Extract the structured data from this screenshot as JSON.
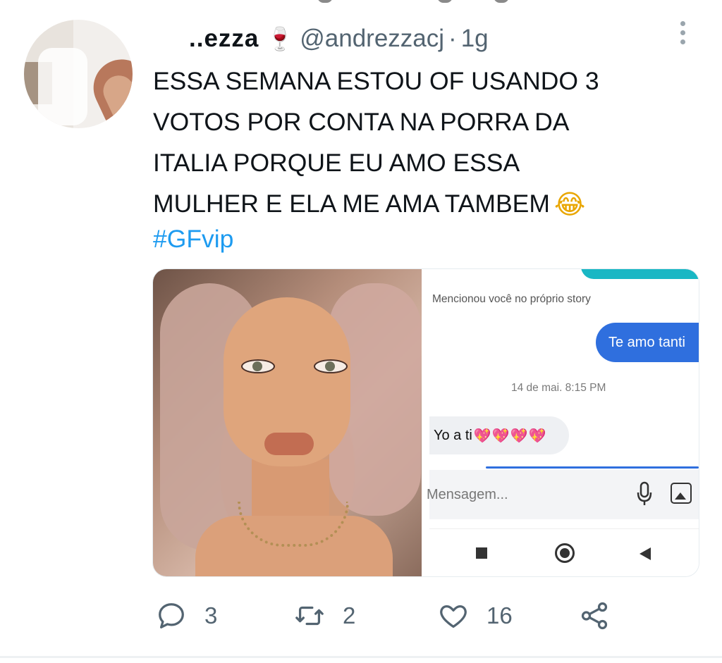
{
  "tweet": {
    "display_name": "..ezza",
    "name_emoji": "🍷",
    "handle": "@andrezzacj",
    "separator": "·",
    "time": "1g",
    "text": "ESSA SEMANA ESTOU OF USANDO 3\nVOTOS POR CONTA NA PORRA DA\nITALIA PORQUE EU AMO ESSA\nMULHER E ELA ME AMA TAMBEM",
    "text_emoji": "😂",
    "hashtag": "#GFvip"
  },
  "chat_screenshot": {
    "mention_text": "Mencionou você no próprio story",
    "outgoing_message": "Te amo tanti",
    "timestamp": "14 de mai. 8:15 PM",
    "incoming_message": "Yo a ti",
    "incoming_hearts": "💖💖💖💖",
    "input_placeholder": "Mensagem..."
  },
  "actions": {
    "replies": "3",
    "retweets": "2",
    "likes": "16"
  },
  "icons": [
    "more-icon",
    "reply-icon",
    "retweet-icon",
    "like-icon",
    "share-icon",
    "mic-icon",
    "image-icon"
  ],
  "colors": {
    "link": "#1d9bf0",
    "secondary_text": "#536471",
    "chat_bubble": "#2f6fde",
    "chat_topbar": "#19b7c4"
  }
}
